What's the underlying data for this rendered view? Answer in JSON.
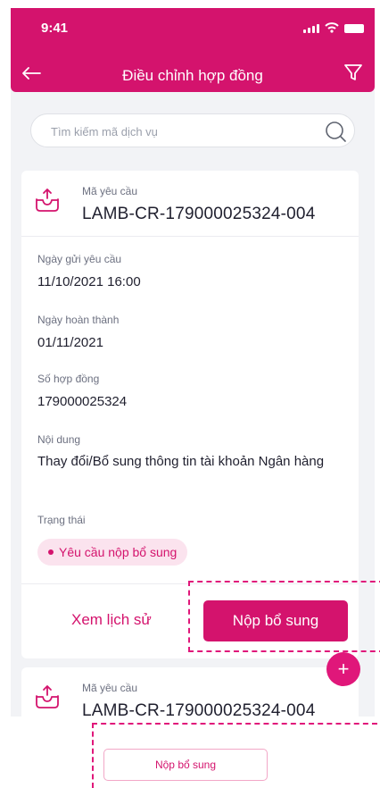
{
  "status_bar": {
    "time": "9:41"
  },
  "header": {
    "title": "Điều chỉnh hợp đồng"
  },
  "search": {
    "placeholder": "Tìm kiếm mã dịch vụ"
  },
  "cards": [
    {
      "code_label": "Mã yêu cầu",
      "code": "LAMB-CR-179000025324-004",
      "fields": [
        {
          "label": "Ngày gửi yêu cầu",
          "value": "11/10/2021 16:00"
        },
        {
          "label": "Ngày hoàn thành",
          "value": "01/11/2021"
        },
        {
          "label": "Số hợp đồng",
          "value": "179000025324"
        },
        {
          "label": "Nội dung",
          "value": "Thay đổi/Bổ sung thông tin tài khoản Ngân hàng"
        }
      ],
      "status_label": "Trạng thái",
      "status": "Yêu cầu nộp bổ sung",
      "history_label": "Xem lịch sử",
      "submit_label": "Nộp bổ sung"
    },
    {
      "code_label": "Mã yêu cầu",
      "code": "LAMB-CR-179000025324-004"
    }
  ],
  "fab": {
    "label": "+"
  },
  "outline_button": {
    "label": "Nộp bổ sung"
  },
  "colors": {
    "primary": "#d4136d",
    "badge_bg": "#fbe3ee",
    "background": "#f2f3f6"
  }
}
